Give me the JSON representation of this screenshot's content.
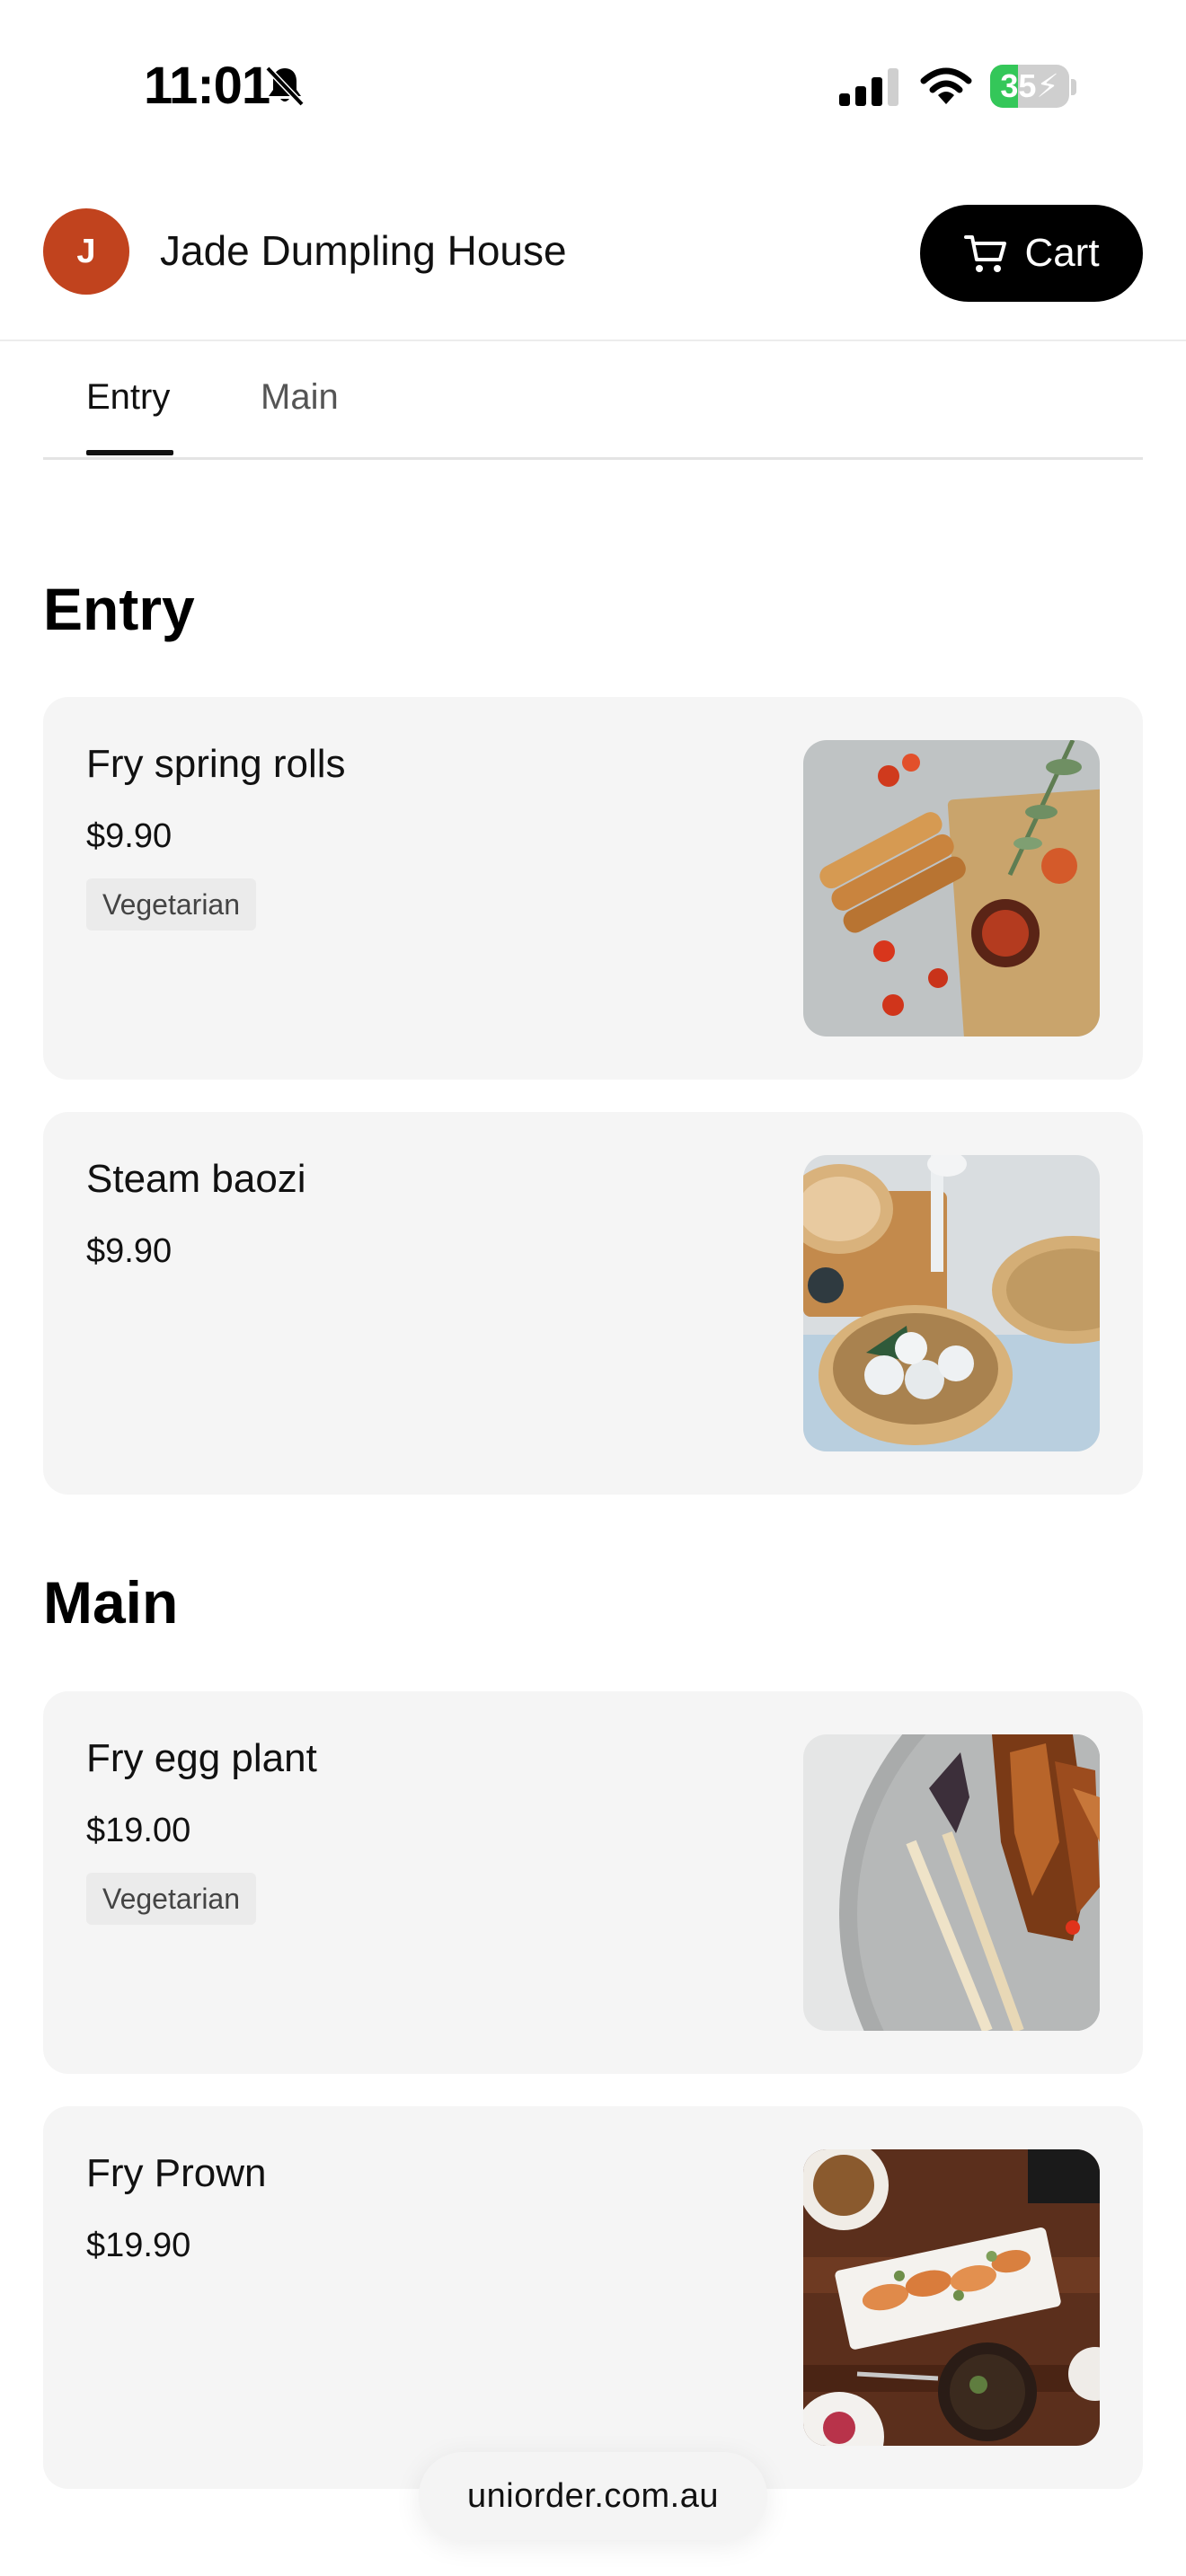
{
  "status_bar": {
    "time": "11:01",
    "battery_level": "35",
    "battery_fraction": 0.35,
    "icons": [
      "bell-slash-icon",
      "cellular-signal-icon",
      "wifi-icon",
      "battery-charging-icon"
    ]
  },
  "header": {
    "avatar_initial": "J",
    "avatar_color": "#c1431e",
    "restaurant_name": "Jade Dumpling House",
    "cart_label": "Cart",
    "cart_icon": "shopping-cart-icon"
  },
  "tabs": [
    {
      "label": "Entry",
      "active": true
    },
    {
      "label": "Main",
      "active": false
    }
  ],
  "sections": [
    {
      "title": "Entry",
      "items": [
        {
          "name": "Fry spring rolls",
          "price": "$9.90",
          "tag": "Vegetarian",
          "photo": "spring-rolls-photo"
        },
        {
          "name": "Steam baozi",
          "price": "$9.90",
          "tag": "",
          "photo": "baozi-photo"
        }
      ]
    },
    {
      "title": "Main",
      "items": [
        {
          "name": "Fry egg plant",
          "price": "$19.00",
          "tag": "Vegetarian",
          "photo": "eggplant-photo"
        },
        {
          "name": "Fry Prown",
          "price": "$19.90",
          "tag": "",
          "photo": "prawn-photo"
        }
      ]
    }
  ],
  "footer": {
    "url": "uniorder.com.au"
  }
}
